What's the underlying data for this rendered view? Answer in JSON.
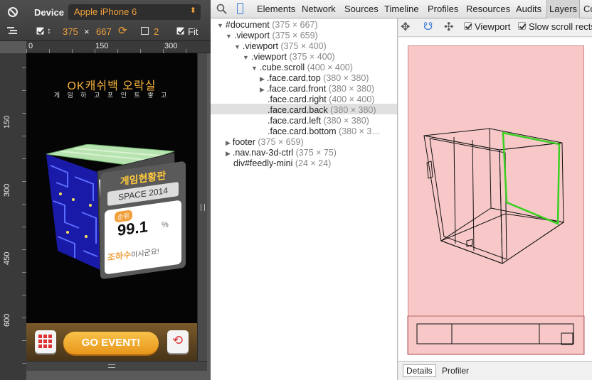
{
  "device": {
    "label": "Device",
    "model": "Apple iPhone 6",
    "width": "375",
    "times": "×",
    "height": "667",
    "scale": "2",
    "fit": "Fit",
    "ruler_top": [
      "0",
      "150",
      "300"
    ],
    "ruler_left": [
      "150",
      "300",
      "450",
      "600"
    ]
  },
  "phone": {
    "brand": "OK캐쉬백 오락실",
    "subtitle": "게 임 하 고 포 인 트 쌓 고",
    "board_title": "게임현황판",
    "space": "SPACE 2014",
    "rank_badge": "순위",
    "percent": "99.1",
    "percent_unit": "%",
    "message_name": "조하수",
    "message_rest": "이시군요!",
    "go_button": "GO EVENT!"
  },
  "tabs": [
    "Elements",
    "Network",
    "Sources",
    "Timeline",
    "Profiles",
    "Resources",
    "Audits",
    "Layers",
    "Co"
  ],
  "active_tab": "Layers",
  "tree": [
    {
      "name": "#document",
      "dims": "(375 × 667)",
      "tri": "▼"
    },
    {
      "name": ".viewport",
      "dims": "(375 × 659)",
      "tri": "▼"
    },
    {
      "name": ".viewport",
      "dims": "(375 × 400)",
      "tri": "▼"
    },
    {
      "name": ".viewport",
      "dims": "(375 × 400)",
      "tri": "▼"
    },
    {
      "name": ".cube.scroll",
      "dims": "(400 × 400)",
      "tri": "▼"
    },
    {
      "name": ".face.card.top",
      "dims": "(380 × 380)",
      "tri": "▶"
    },
    {
      "name": ".face.card.front",
      "dims": "(380 × 380)",
      "tri": "▶"
    },
    {
      "name": ".face.card.right",
      "dims": "(400 × 400)",
      "tri": ""
    },
    {
      "name": ".face.card.back",
      "dims": "(380 × 380)",
      "tri": ""
    },
    {
      "name": ".face.card.left",
      "dims": "(380 × 380)",
      "tri": ""
    },
    {
      "name": ".face.card.bottom",
      "dims": "(380 × 3…",
      "tri": ""
    },
    {
      "name": "footer",
      "dims": "(375 × 659)",
      "tri": "▶"
    },
    {
      "name": ".nav.nav-3d-ctrl",
      "dims": "(375 × 75)",
      "tri": "▶"
    },
    {
      "name": "div#feedly-mini",
      "dims": "(24 × 24)",
      "tri": ""
    }
  ],
  "layers": {
    "viewport_label": "Viewport",
    "slow_scroll_label": "Slow scroll rects",
    "details_tab": "Details",
    "profiler_tab": "Profiler"
  },
  "colors": {
    "accent_orange": "#f0a03c",
    "layer_background": "#f8c8c8",
    "highlight_green": "#38d020"
  }
}
